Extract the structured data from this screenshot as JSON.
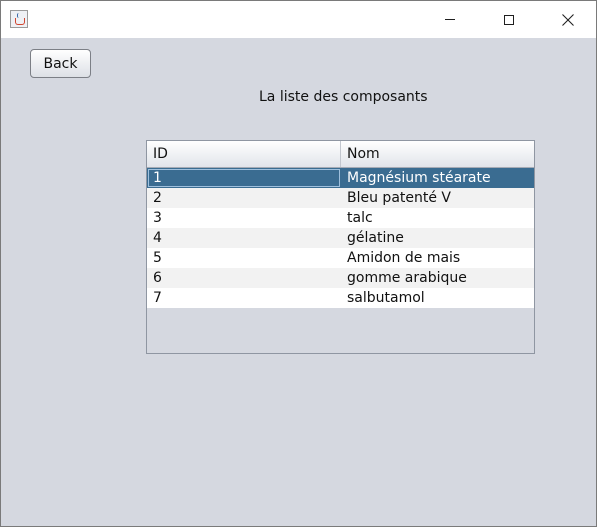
{
  "window": {
    "title": ""
  },
  "back_button": {
    "label": "Back"
  },
  "page_title": "La liste des composants",
  "table": {
    "columns": [
      "ID",
      "Nom"
    ],
    "rows": [
      {
        "id": "1",
        "nom": "Magnésium stéarate",
        "selected": true
      },
      {
        "id": "2",
        "nom": "Bleu patenté V"
      },
      {
        "id": "3",
        "nom": "talc"
      },
      {
        "id": "4",
        "nom": "gélatine"
      },
      {
        "id": "5",
        "nom": "Amidon de mais"
      },
      {
        "id": "6",
        "nom": "gomme arabique"
      },
      {
        "id": "7",
        "nom": "salbutamol"
      }
    ]
  },
  "colors": {
    "selection": "#3a6c91",
    "panel_bg": "#d5d8e0",
    "stripe": "#f2f2f2"
  },
  "icons": {
    "app": "java-app-icon",
    "minimize": "minimize-icon",
    "maximize": "maximize-icon",
    "close": "close-icon"
  }
}
